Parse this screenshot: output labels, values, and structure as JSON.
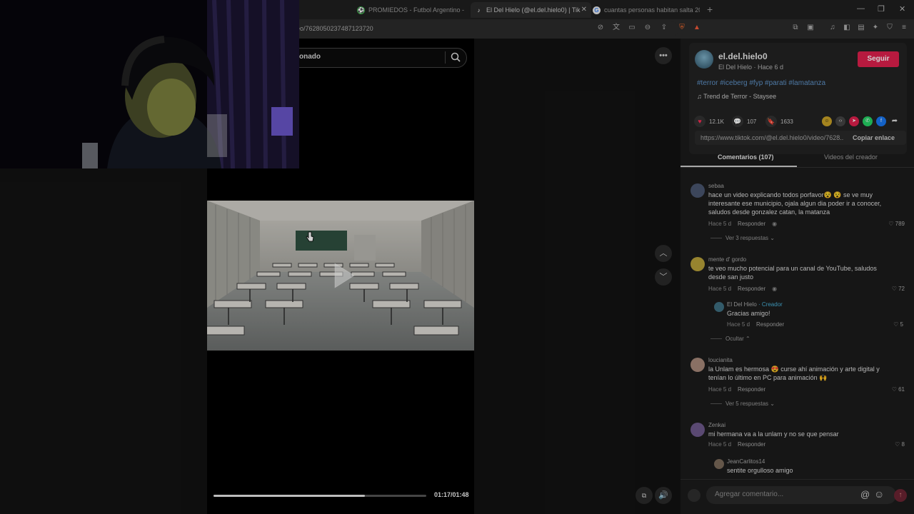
{
  "browser": {
    "tabs": [
      {
        "label": "PROMIEDOS - Futbol Argentino - Fix",
        "icon": "soccer-ball-icon",
        "active": false
      },
      {
        "label": "El Del Hielo (@el.del.hielo0) | Tik",
        "icon": "tiktok-icon",
        "active": true
      },
      {
        "label": "cuantas personas habitan salta 2026",
        "icon": "google-icon",
        "active": false
      }
    ],
    "new_tab": "+",
    "url": "eo/7628050237487123720",
    "accent": "#e0204d"
  },
  "video": {
    "search_text": "onado",
    "time": "01:17/01:48",
    "progress": 0.713
  },
  "author": {
    "name": "el.del.hielo0",
    "meta": "El Del Hielo · Hace 6 d",
    "follow": "Seguir",
    "hashtags": "#terror #iceberg #fyp #parati #lamatanza",
    "music": "Trend de Terror - Staysee"
  },
  "stats": {
    "likes": "12.1K",
    "comments": "107",
    "saves": "1633"
  },
  "link": {
    "url": "https://www.tiktok.com/@el.del.hielo0/video/7628...",
    "copy": "Copiar enlace"
  },
  "tabs": {
    "comments": "Comentarios (107)",
    "creator_videos": "Videos del creador"
  },
  "comments": [
    {
      "user": "sebaa",
      "text": "hace un video explicando todos porfavor😵 😵 se ve muy interesante ese municipio, ojala algun dia poder ir a conocer, saludos desde gonzalez catan, la matanza",
      "date": "Hace 5 d",
      "reply": "Responder",
      "likes": "789",
      "more": "Ver 3 respuestas"
    },
    {
      "user": "mente d' gordo",
      "text": "te veo mucho potencial para un canal de YouTube, saludos desde san justo",
      "date": "Hace 5 d",
      "reply": "Responder",
      "likes": "72",
      "more": "Ocultar"
    },
    {
      "user": "loucianita",
      "text": "la Unlam es hermosa 😍 curse ahí animación y arte digital y tenían lo último en PC para animación 🙌",
      "date": "Hace 5 d",
      "reply": "Responder",
      "likes": "61",
      "more": "Ver 5 respuestas"
    },
    {
      "user": "Zenkai",
      "text": "mi hermana va a la unlam y no se que pensar",
      "date": "Hace 5 d",
      "reply": "Responder",
      "likes": "8"
    }
  ],
  "replies": [
    {
      "user": "El Del Hielo",
      "badge": "· Creador",
      "text": "Gracias amigo!",
      "date": "Hace 5 d",
      "reply": "Responder",
      "likes": "5"
    },
    {
      "user": "JeanCarlitos14",
      "text": "sentite orgulloso amigo"
    }
  ],
  "comment_box": {
    "placeholder": "Agregar comentario...",
    "mention": "@",
    "emoji": "☺"
  }
}
